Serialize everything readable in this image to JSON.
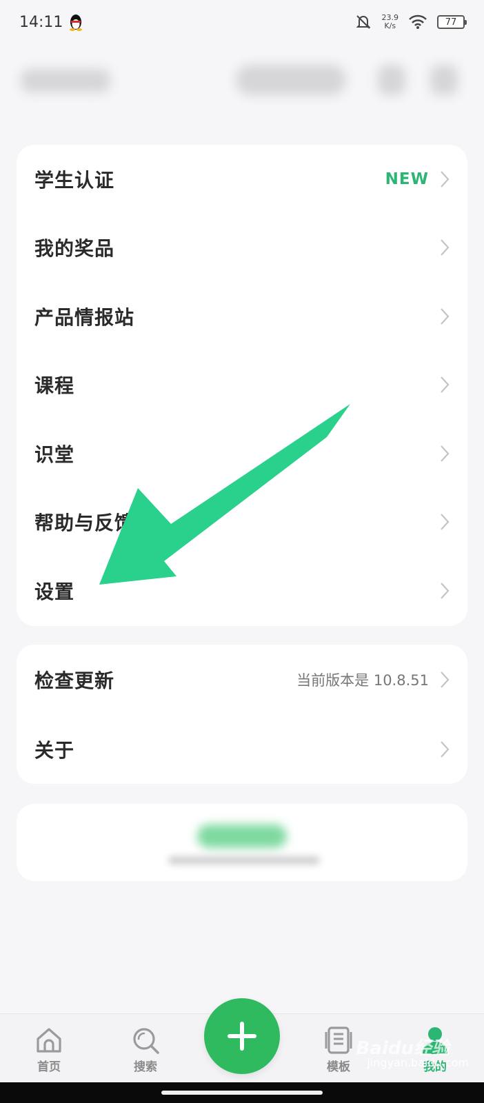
{
  "status_bar": {
    "time": "14:11",
    "net_speed_value": "23.9",
    "net_speed_unit": "K/s",
    "battery": "77"
  },
  "menu_card": {
    "items": [
      {
        "label": "学生认证",
        "badge": "NEW"
      },
      {
        "label": "我的奖品"
      },
      {
        "label": "产品情报站"
      },
      {
        "label": "课程"
      },
      {
        "label": "识堂"
      },
      {
        "label": "帮助与反馈"
      },
      {
        "label": "设置"
      }
    ]
  },
  "update_card": {
    "items": [
      {
        "label": "检查更新",
        "detail": "当前版本是 10.8.51"
      },
      {
        "label": "关于"
      }
    ]
  },
  "tab_bar": {
    "tabs": [
      {
        "label": "首页",
        "icon": "home-icon"
      },
      {
        "label": "搜索",
        "icon": "search-icon"
      },
      {
        "label": "模板",
        "icon": "template-icon"
      },
      {
        "label": "我的",
        "icon": "profile-icon",
        "active": true
      }
    ],
    "fab_icon": "plus-icon"
  },
  "watermark": {
    "logo": "Baidu经验",
    "url": "jingyan.baidu.com"
  },
  "colors": {
    "accent": "#2bb673",
    "fab": "#2fba5f",
    "arrow": "#2ad18c"
  }
}
